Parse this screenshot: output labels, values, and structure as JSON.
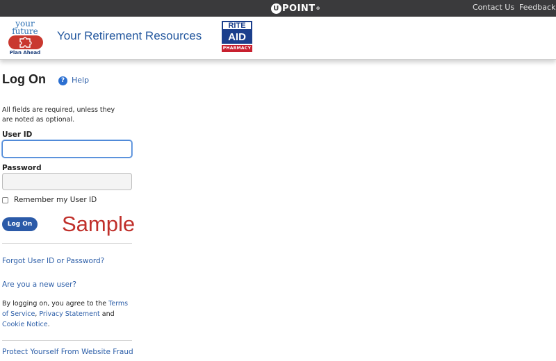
{
  "topbar": {
    "brand_u": "U",
    "brand_rest": "POINT",
    "brand_mark": "®",
    "contact_us": "Contact Us",
    "feedback": "Feedback"
  },
  "header": {
    "logo_line1": "your",
    "logo_line2": "future",
    "logo_tagline": "Plan Ahead",
    "site_title": "Your Retirement Resources",
    "partner_top": "RITE",
    "partner_mid": "AID",
    "partner_bottom": "PHARMACY"
  },
  "login": {
    "title": "Log On",
    "help": "Help",
    "required_note": "All fields are required, unless they are noted as optional.",
    "user_id_label": "User ID",
    "user_id_value": "",
    "password_label": "Password",
    "password_value": "",
    "remember_label": "Remember my User ID",
    "remember_checked": false,
    "logon_button": "Log On",
    "watermark": "Sample"
  },
  "links": {
    "forgot": "Forgot User ID or Password?",
    "new_user": "Are you a new user?",
    "agree_prefix": "By logging on, you agree to the ",
    "terms": "Terms of Service",
    "comma": ", ",
    "privacy": "Privacy Statement",
    "and": " and ",
    "cookie": "Cookie Notice",
    "period": ".",
    "fraud": "Protect Yourself From Website Fraud"
  },
  "colors": {
    "topbar": "#3a3a3c",
    "link": "#2c5ea8",
    "primary_button": "#2b5aa8",
    "watermark": "#c0302b"
  }
}
